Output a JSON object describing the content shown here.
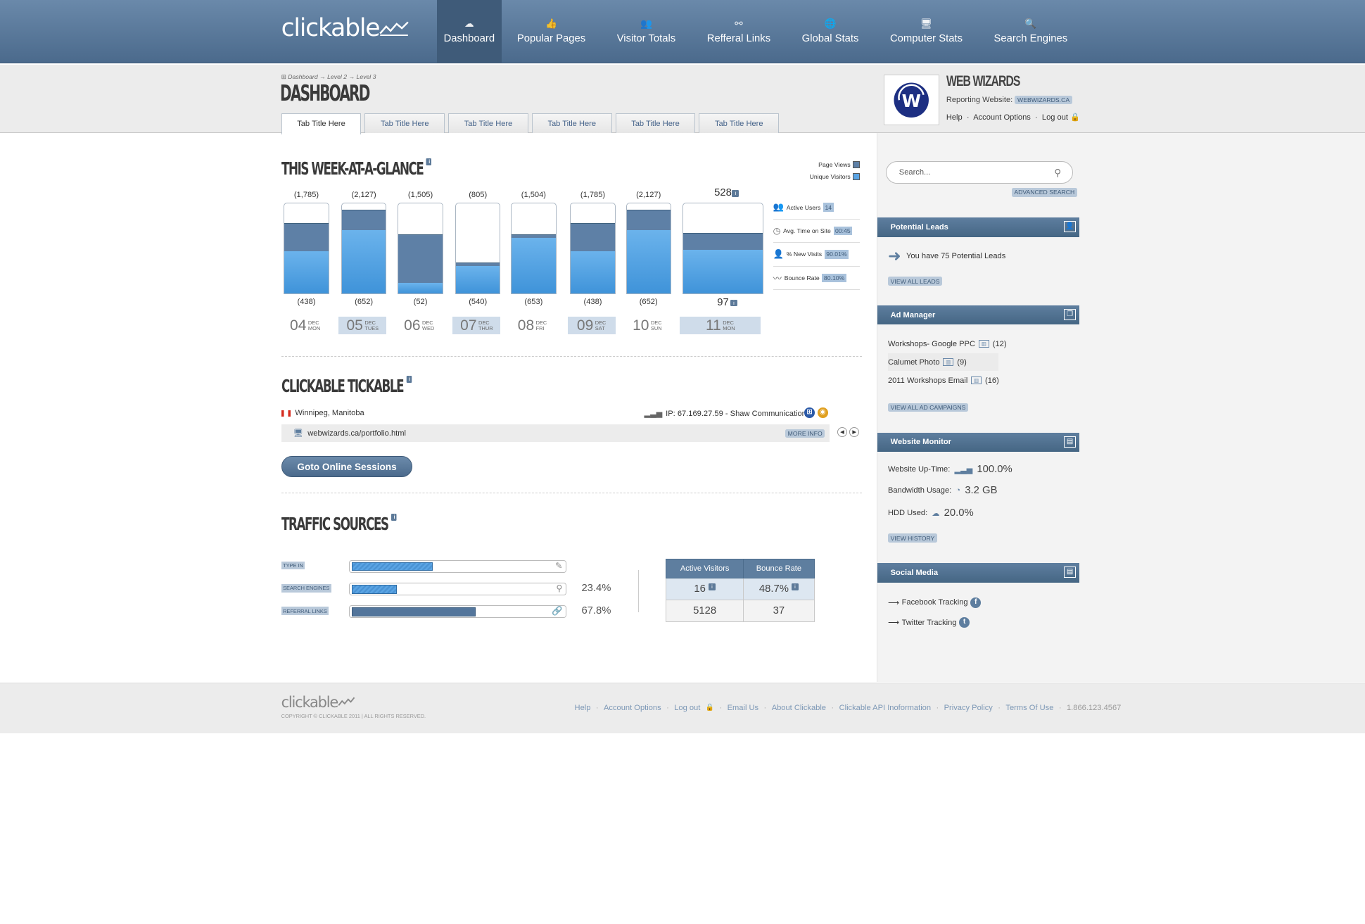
{
  "brand": {
    "logo_text": "clickable"
  },
  "nav": {
    "items": [
      {
        "label": "Dashboard",
        "icon": "cloud-icon",
        "glyph": "☁"
      },
      {
        "label": "Popular Pages",
        "icon": "thumbs-up-icon",
        "glyph": "👍"
      },
      {
        "label": "Visitor Totals",
        "icon": "users-icon",
        "glyph": "👥"
      },
      {
        "label": "Refferal Links",
        "icon": "share-icon",
        "glyph": "⚯"
      },
      {
        "label": "Global Stats",
        "icon": "globe-icon",
        "glyph": "🌐"
      },
      {
        "label": "Computer Stats",
        "icon": "monitor-icon",
        "glyph": "🖥"
      },
      {
        "label": "Search Engines",
        "icon": "search-icon",
        "glyph": "🔍"
      }
    ],
    "active": "Dashboard"
  },
  "breadcrumb": {
    "items": [
      "Dashboard",
      "Level 2",
      "Level 3"
    ],
    "separator": "→"
  },
  "page_title": "DASHBOARD",
  "tabs": [
    "Tab Title Here",
    "Tab Title Here",
    "Tab Title Here",
    "Tab Title Here",
    "Tab Title Here",
    "Tab Title Here"
  ],
  "client": {
    "name": "WEB WIZARDS",
    "reporting_label": "Reporting Website:",
    "reporting_site": "WEBWIZARDS.CA",
    "links": [
      "Help",
      "Account Options",
      "Log out"
    ]
  },
  "week": {
    "title": "THIS WEEK-AT-A-GLANCE",
    "legend": [
      "Page Views",
      "Unique Visitors"
    ],
    "days": [
      {
        "top": "(1,785)",
        "bottom": "(438)",
        "day": "04",
        "month": "DEC",
        "weekday": "MON",
        "pv": 1785,
        "uv": 438
      },
      {
        "top": "(2,127)",
        "bottom": "(652)",
        "day": "05",
        "month": "DEC",
        "weekday": "TUES",
        "pv": 2127,
        "uv": 652
      },
      {
        "top": "(1,505)",
        "bottom": "(52)",
        "day": "06",
        "month": "DEC",
        "weekday": "WED",
        "pv": 1505,
        "uv": 52
      },
      {
        "top": "(805)",
        "bottom": "(540)",
        "day": "07",
        "month": "DEC",
        "weekday": "THUR",
        "pv": 805,
        "uv": 540
      },
      {
        "top": "(1,504)",
        "bottom": "(653)",
        "day": "08",
        "month": "DEC",
        "weekday": "FRI",
        "pv": 1504,
        "uv": 653
      },
      {
        "top": "(1,785)",
        "bottom": "(438)",
        "day": "09",
        "month": "DEC",
        "weekday": "SAT",
        "pv": 1785,
        "uv": 438
      },
      {
        "top": "(2,127)",
        "bottom": "(652)",
        "day": "10",
        "month": "DEC",
        "weekday": "SUN",
        "pv": 2127,
        "uv": 652
      },
      {
        "top": "528",
        "bottom": "97",
        "day": "11",
        "month": "DEC",
        "weekday": "MON",
        "pv": 528,
        "uv": 97
      }
    ],
    "stats": [
      {
        "label": "Active Users",
        "value": "14",
        "icon": "users-icon"
      },
      {
        "label": "Avg. Time on Site",
        "value": "00:45",
        "icon": "clock-icon"
      },
      {
        "label": "% New Visits",
        "value": "90.01%",
        "icon": "new-user-icon"
      },
      {
        "label": "Bounce Rate",
        "value": "80.10%",
        "icon": "pulse-icon"
      }
    ]
  },
  "tickable": {
    "title": "CLICKABLE TICKABLE",
    "location": "Winnipeg, Manitoba",
    "ip": "IP: 67.169.27.59 - Shaw Communications",
    "url": "webwizards.ca/portfolio.html",
    "more_info": "MORE INFO",
    "button": "Goto Online Sessions"
  },
  "traffic": {
    "title": "TRAFFIC SOURCES",
    "sources": [
      {
        "label": "TYPE IN",
        "fraction": 0.38,
        "pct": "",
        "icon": "edit-icon",
        "dark": false
      },
      {
        "label": "SEARCH ENGINES",
        "fraction": 0.21,
        "pct": "23.4%",
        "icon": "search-icon",
        "dark": false
      },
      {
        "label": "REFERRAL LINKS",
        "fraction": 0.58,
        "pct": "67.8%",
        "icon": "link-icon",
        "dark": true
      }
    ],
    "table": {
      "headers": [
        "Active Visitors",
        "Bounce Rate"
      ],
      "rows": [
        [
          "16",
          "48.7%"
        ],
        [
          "5128",
          "37"
        ]
      ]
    }
  },
  "sidebar": {
    "search_placeholder": "Search...",
    "advanced_search": "ADVANCED SEARCH",
    "leads": {
      "title": "Potential Leads",
      "text": "You have 75 Potential Leads",
      "link": "VIEW ALL LEADS"
    },
    "ads": {
      "title": "Ad Manager",
      "items": [
        {
          "name": "Workshops- Google PPC",
          "count": "(12)"
        },
        {
          "name": "Calumet Photo",
          "count": "(9)"
        },
        {
          "name": "2011 Workshops Email",
          "count": "(16)"
        }
      ],
      "link": "VIEW ALL AD CAMPAIGNS"
    },
    "monitor": {
      "title": "Website Monitor",
      "uptime_label": "Website Up-Time:",
      "uptime": "100.0%",
      "bandwidth_label": "Bandwidth Usage:",
      "bandwidth": "3.2 GB",
      "hdd_label": "HDD Used:",
      "hdd": "20.0%",
      "link": "VIEW HISTORY"
    },
    "social": {
      "title": "Social Media",
      "items": [
        "Facebook Tracking",
        "Twitter Tracking"
      ]
    }
  },
  "footer": {
    "logo_text": "clickable",
    "copyright": "COPYRIGHT © CLICKABLE 2011 | ALL RIGHTS RESERVED.",
    "links": [
      "Help",
      "Account Options",
      "Log out",
      "Email Us",
      "About Clickable",
      "Clickable API Inoformation",
      "Privacy Policy",
      "Terms Of Use",
      "1.866.123.4567"
    ]
  },
  "colors": {
    "accent": "#4b6a8c",
    "bar_blue": "#3f93d9",
    "bar_dark": "#5e80a6"
  }
}
